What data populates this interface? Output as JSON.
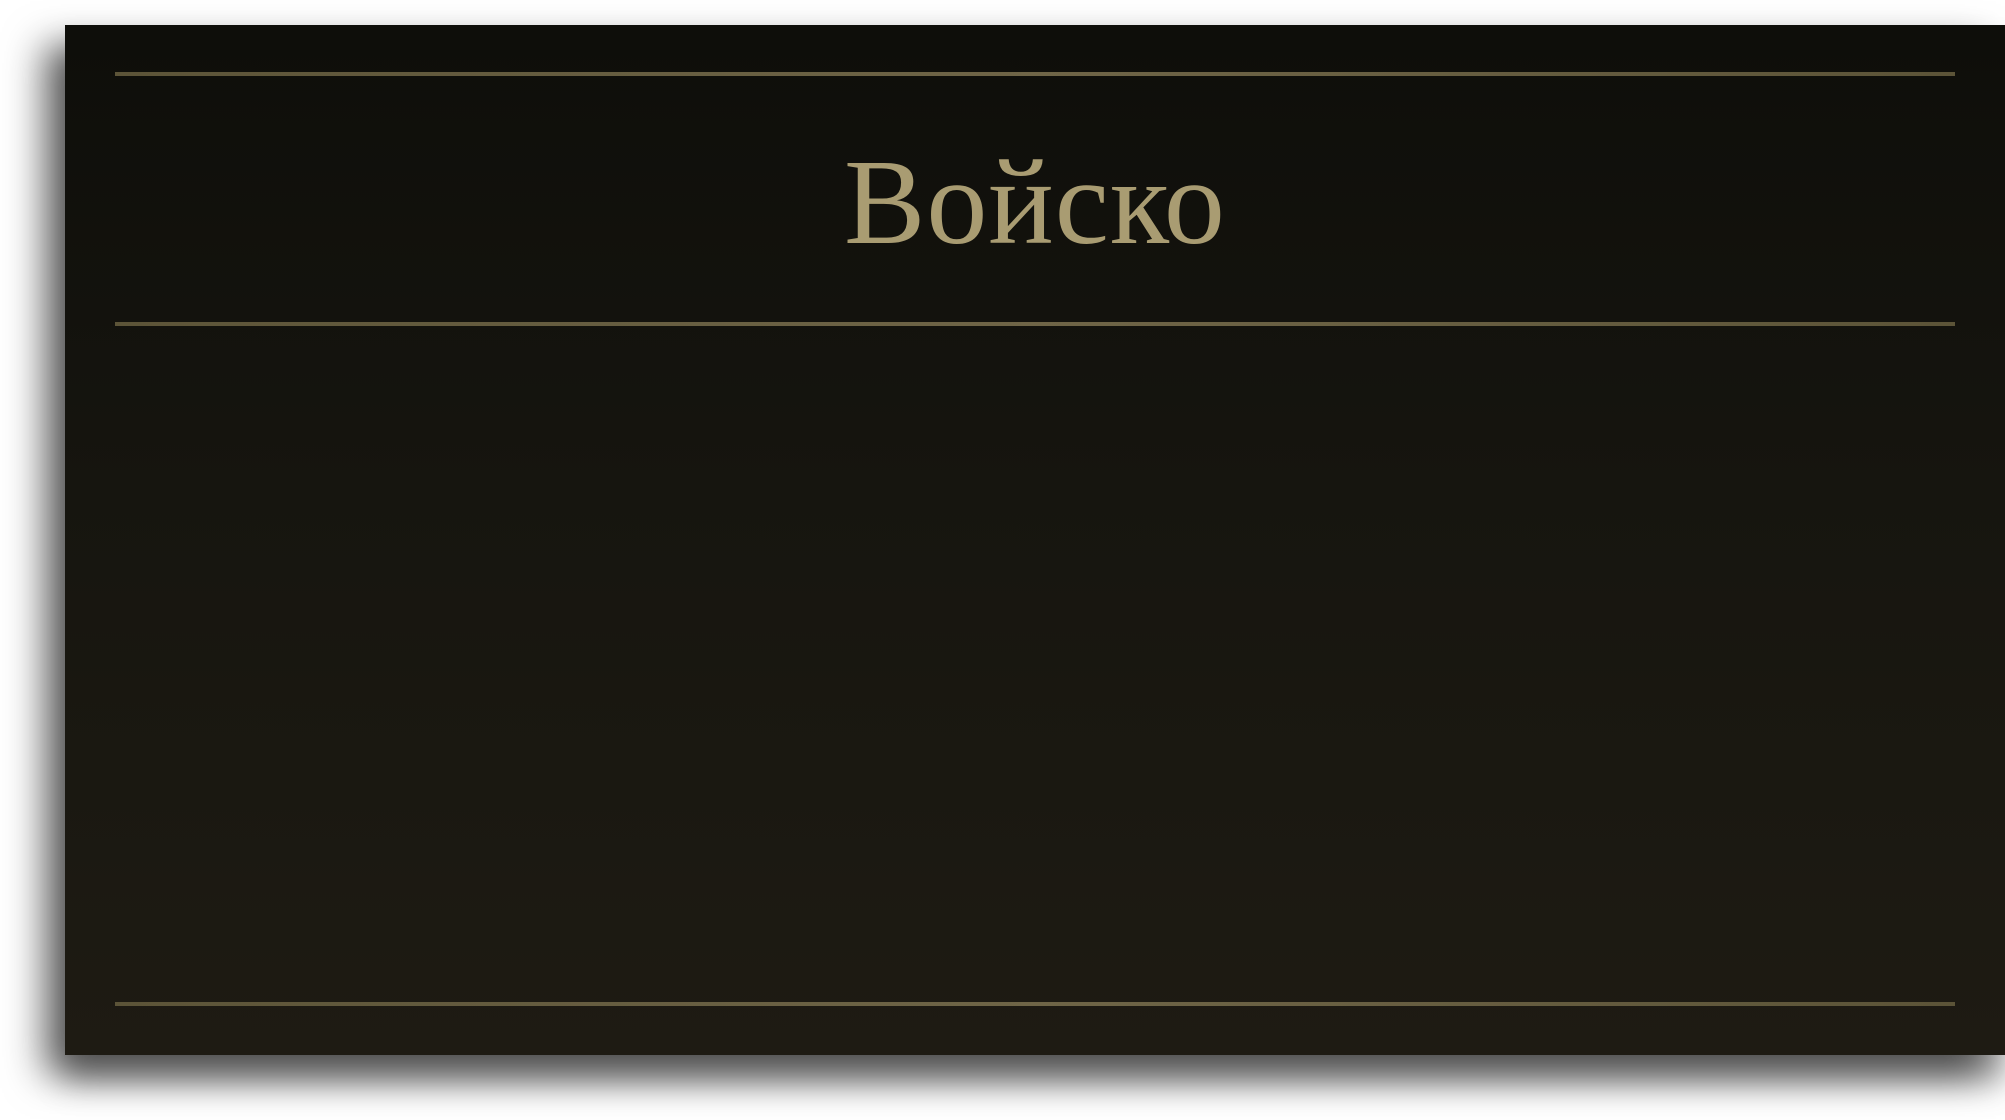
{
  "panel": {
    "title": "Войско"
  },
  "colors": {
    "background_top": "#0e0e0a",
    "background_bottom": "#1e1b13",
    "accent_gold": "#a99c72",
    "rule_color": "#6f6547"
  }
}
